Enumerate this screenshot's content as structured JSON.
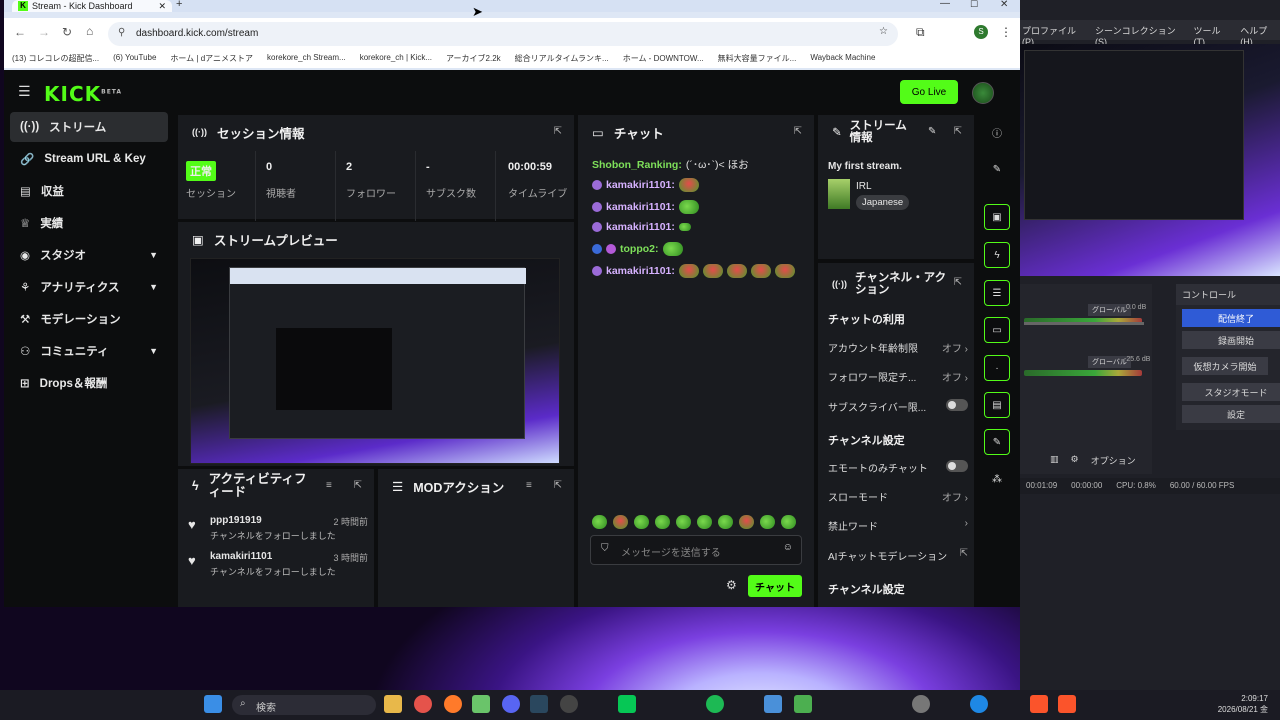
{
  "browser": {
    "tab_title": "Stream - Kick Dashboard",
    "url": "dashboard.kick.com/stream",
    "bookmarks": [
      "(13) コレコレの超配信...",
      "(6) YouTube",
      "ホーム | dアニメストア",
      "korekore_ch Stream...",
      "korekore_ch | Kick...",
      "アーカイブ2.2k",
      "総合リアルタイムランキ...",
      "ホーム - DOWNTOW...",
      "無料大容量ファイル...",
      "Wayback Machine"
    ],
    "profile_initial": "S"
  },
  "header": {
    "logo": "KICK",
    "logo_sup": "BETA",
    "go_live": "Go Live"
  },
  "sidebar": {
    "items": [
      {
        "label": "ストリーム",
        "icon": "broadcast-icon"
      },
      {
        "label": "Stream URL & Key",
        "icon": "link-icon"
      },
      {
        "label": "収益",
        "icon": "wallet-icon"
      },
      {
        "label": "実績",
        "icon": "trophy-icon"
      },
      {
        "label": "スタジオ",
        "icon": "palette-icon"
      },
      {
        "label": "アナリティクス",
        "icon": "analytics-icon"
      },
      {
        "label": "モデレーション",
        "icon": "hammer-icon"
      },
      {
        "label": "コミュニティ",
        "icon": "people-icon"
      },
      {
        "label": "Drops＆報酬",
        "icon": "gift-icon"
      }
    ]
  },
  "session": {
    "title": "セッション情報",
    "status_badge": "正常",
    "status_label": "セッション",
    "viewers_value": "0",
    "viewers_label": "視聴者",
    "followers_value": "2",
    "followers_label": "フォロワー",
    "subs_value": "-",
    "subs_label": "サブスク数",
    "uptime_value": "00:00:59",
    "uptime_label": "タイムライブ"
  },
  "preview": {
    "title": "ストリームプレビュー"
  },
  "activity": {
    "title": "アクティビティフィード",
    "items": [
      {
        "user": "ppp191919",
        "text": "チャンネルをフォローしました",
        "time": "2 時間前"
      },
      {
        "user": "kamakiri1101",
        "text": "チャンネルをフォローしました",
        "time": "3 時間前"
      }
    ]
  },
  "mod_actions": {
    "title": "MODアクション"
  },
  "chat": {
    "title": "チャット",
    "messages": [
      {
        "user": "Shobon_Ranking:",
        "text": "(´･ω･`)< ほお"
      },
      {
        "user": "kamakiri1101:",
        "text": ""
      },
      {
        "user": "kamakiri1101:",
        "text": ""
      },
      {
        "user": "kamakiri1101:",
        "text": ""
      },
      {
        "user": "toppo2:",
        "text": ""
      },
      {
        "user": "kamakiri1101:",
        "text": ""
      }
    ],
    "input_placeholder": "メッセージを送信する",
    "send_label": "チャット"
  },
  "stream_info": {
    "title": "ストリーム情報",
    "stream_title": "My first stream.",
    "category": "IRL",
    "language": "Japanese"
  },
  "channel_actions": {
    "title": "チャンネル・アクション",
    "chat_usage_title": "チャットの利用",
    "rows": [
      {
        "label": "アカウント年齢制限",
        "value": "オフ"
      },
      {
        "label": "フォロワー限定チ...",
        "value": "オフ"
      },
      {
        "label": "サブスクライバー限...",
        "value": ""
      }
    ],
    "channel_settings_title": "チャンネル設定",
    "rows2": [
      {
        "label": "エモートのみチャット",
        "value": ""
      },
      {
        "label": "スローモード",
        "value": "オフ"
      },
      {
        "label": "禁止ワード",
        "value": ""
      },
      {
        "label": "AIチャットモデレーション",
        "value": ""
      }
    ],
    "channel_settings_title2": "チャンネル設定"
  },
  "obs": {
    "menu": [
      "プロファイル(P)",
      "シーンコレクション(S)",
      "ツール(T)",
      "ヘルプ(H)"
    ],
    "mixer_labels": [
      "グローバル",
      "0.0 dB",
      "グローバル",
      "-25.6 dB"
    ],
    "control_title": "コントロール",
    "controls": [
      "配信終了",
      "録画開始",
      "仮想カメラ開始",
      "スタジオモード",
      "設定"
    ],
    "options_label": "オプション",
    "status": [
      "00:01:09",
      "00:00:00",
      "CPU: 0.8%",
      "60.00 / 60.00 FPS"
    ]
  },
  "taskbar": {
    "search_label": "検索",
    "time": "2:09:17",
    "date": "2026/08/21 金"
  },
  "colors": {
    "accent": "#53fc18",
    "panel": "#191b1f",
    "bg": "#0c0d0e"
  }
}
